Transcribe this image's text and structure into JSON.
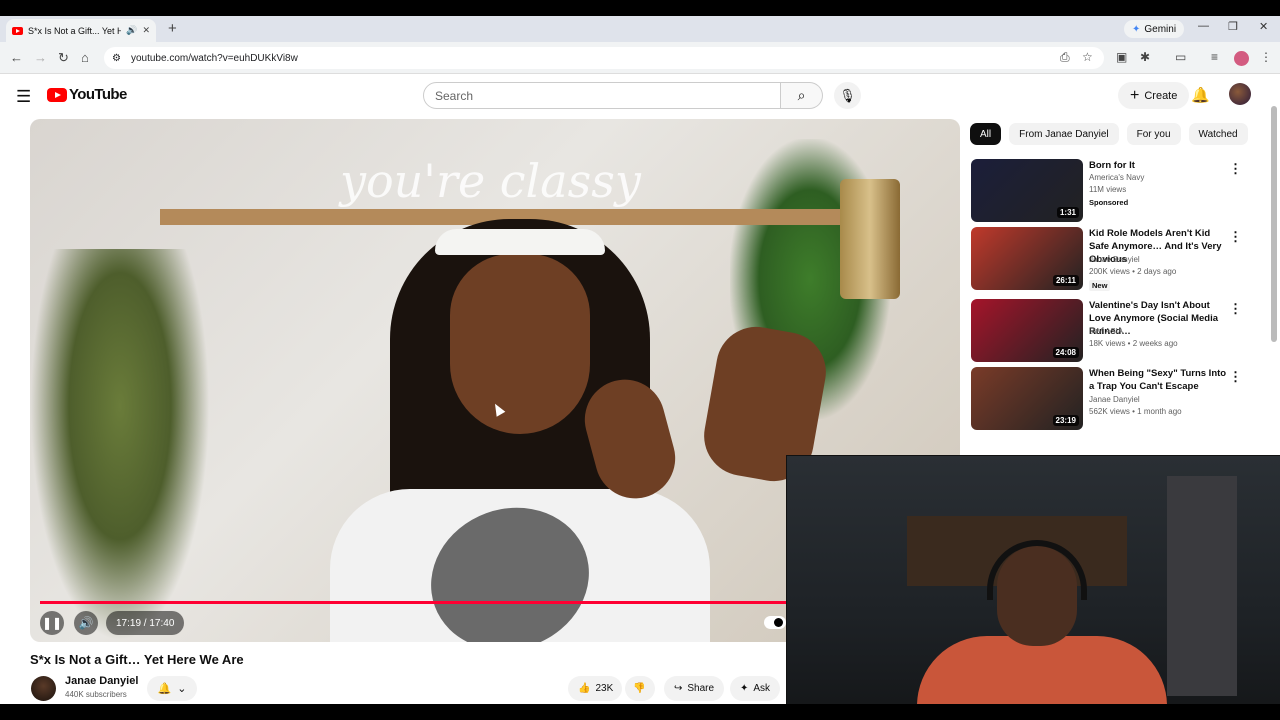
{
  "browser": {
    "tab_title": "S*x Is Not a Gift... Yet Here",
    "new_tab": "+",
    "gemini_label": "Gemini",
    "url": "youtube.com/watch?v=euhDUKkVi8w",
    "minimize": "—",
    "restore": "❐",
    "close": "✕"
  },
  "header": {
    "logo_text": "YouTube",
    "search_placeholder": "Search",
    "create_label": "Create"
  },
  "player": {
    "time": "17:19 / 17:40",
    "progress": 0.98,
    "neon_text": "you're classy"
  },
  "video": {
    "title": "S*x Is Not a Gift… Yet Here We Are",
    "channel": "Janae Danyiel",
    "subscribers": "440K subscribers",
    "likes": "23K",
    "share_label": "Share",
    "ask_label": "Ask"
  },
  "chips": [
    "All",
    "From Janae Danyiel",
    "For you",
    "Watched"
  ],
  "recommendations": [
    {
      "title": "Born for It",
      "channel": "America's Navy",
      "meta": "11M views",
      "badge": "Sponsored",
      "duration": "1:31",
      "color": "#1b1e3a"
    },
    {
      "title": "Kid Role Models Aren't Kid Safe Anymore… And It's Very Obvious",
      "channel": "Janae Danyiel",
      "meta": "200K views • 2 days ago",
      "badge": "New",
      "duration": "26:11",
      "color": "#c0392b"
    },
    {
      "title": "Valentine's Day Isn't About Love Anymore (Social Media Ruined…",
      "channel": "IAM ASIA",
      "meta": "18K views • 2 weeks ago",
      "badge": "",
      "duration": "24:08",
      "color": "#a5142a"
    },
    {
      "title": "When Being \"Sexy\" Turns Into a Trap You Can't Escape",
      "channel": "Janae Danyiel",
      "meta": "562K views • 1 month ago",
      "badge": "",
      "duration": "23:19",
      "color": "#7a3b28"
    }
  ]
}
